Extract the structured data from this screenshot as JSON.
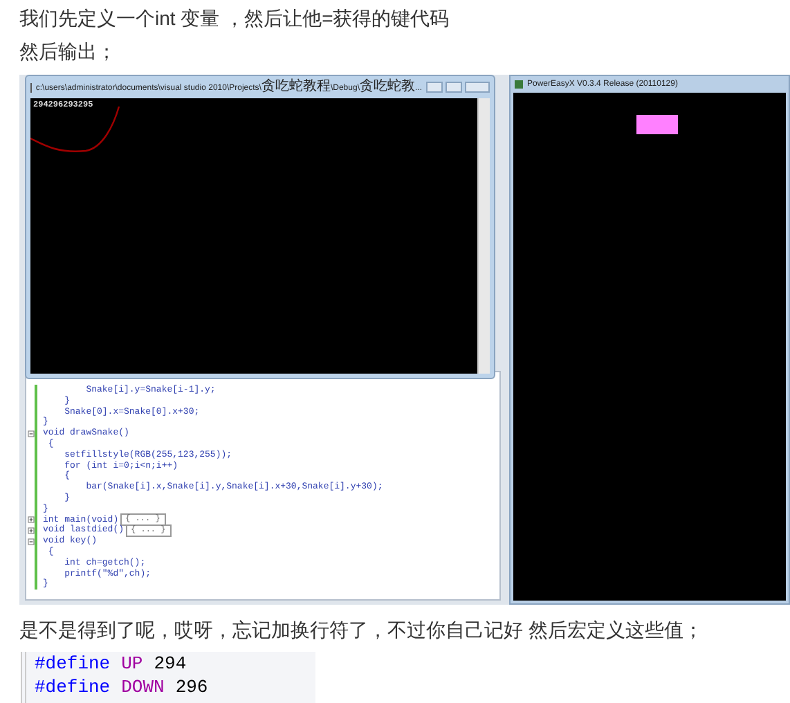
{
  "intro": [
    "我们先定义一个int 变量 ，然后让他=获得的键代码",
    "然后输出；"
  ],
  "screenshot": {
    "console": {
      "title": "c:\\users\\administrator\\documents\\visual studio 2010\\Projects\\贪吃蛇教程\\Debug\\贪吃蛇教...",
      "output": "294296293295"
    },
    "editor_lines": [
      {
        "text": "        Snake[i].y=Snake[i-1].y;"
      },
      {
        "text": "    }"
      },
      {
        "text": "    Snake[0].x=Snake[0].x+30;"
      },
      {
        "text": "}"
      },
      {
        "text": "void drawSnake()",
        "expanded": true
      },
      {
        "text": " {"
      },
      {
        "text": "    setfillstyle(RGB(255,123,255));"
      },
      {
        "text": "    for (int i=0;i<n;i++)"
      },
      {
        "text": "    {"
      },
      {
        "text": "        bar(Snake[i].x,Snake[i].y,Snake[i].x+30,Snake[i].y+30);"
      },
      {
        "text": "    }"
      },
      {
        "text": "}"
      },
      {
        "text": "int main(void)",
        "expanded": false,
        "collapsed": "{ ... }"
      },
      {
        "text": "void lastdied()",
        "expanded": false,
        "collapsed": "{ ... }"
      },
      {
        "text": "void key()",
        "expanded": true
      },
      {
        "text": " {"
      },
      {
        "text": "    int ch=getch();"
      },
      {
        "text": "    printf(\"%d\",ch);"
      },
      {
        "text": "}"
      }
    ],
    "game_window": {
      "title": "PowerEasyX V0.3.4 Release (20110129)"
    }
  },
  "paragraph": "是不是得到了呢，哎呀，忘记加换行符了，不过你自己记好 然后宏定义这些值；",
  "defines": [
    {
      "directive": "#define",
      "name": "UP",
      "value": "294"
    },
    {
      "directive": "#define",
      "name": "DOWN",
      "value": "296"
    }
  ]
}
